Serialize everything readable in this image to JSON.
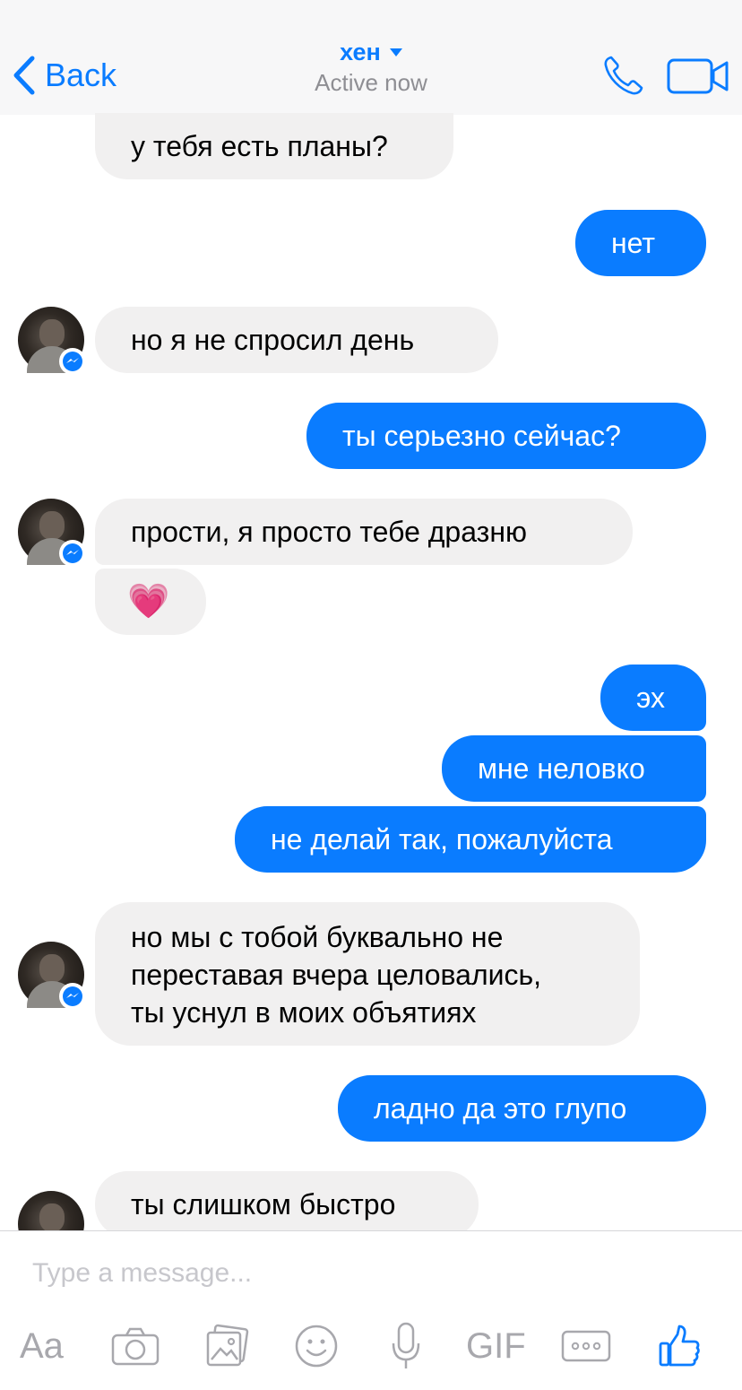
{
  "header": {
    "back_label": "Back",
    "contact_name": "хен",
    "status": "Active now"
  },
  "messages": [
    {
      "sender": "them",
      "text": "у тебя есть планы?"
    },
    {
      "sender": "me",
      "text": "нет"
    },
    {
      "sender": "them",
      "text": "но я не спросил день"
    },
    {
      "sender": "me",
      "text": "ты серьезно сейчас?"
    },
    {
      "sender": "them",
      "text": "прости, я просто тебе дразню"
    },
    {
      "sender": "them",
      "text": "💗"
    },
    {
      "sender": "me",
      "text": "эх"
    },
    {
      "sender": "me",
      "text": "мне неловко"
    },
    {
      "sender": "me",
      "text": "не делай так, пожалуйста"
    },
    {
      "sender": "them",
      "lines": [
        "но мы с тобой буквально не",
        "переставая вчера целовались,",
        "ты уснул в моих объятиях"
      ]
    },
    {
      "sender": "me",
      "text": "ладно да это глупо"
    },
    {
      "sender": "them",
      "text": "ты слишком быстро"
    }
  ],
  "composer": {
    "placeholder": "Type a message...",
    "text_button": "Aa",
    "gif_button": "GIF"
  },
  "colors": {
    "accent": "#0a7cff",
    "incoming_bubble": "#f1f0f0",
    "outgoing_bubble": "#0a7cff",
    "header_bg": "#f7f7f8",
    "toolbar_icon": "#a8a8ad"
  },
  "icons": [
    "chevron-left-icon",
    "caret-down-icon",
    "phone-icon",
    "video-camera-icon",
    "messenger-badge-icon",
    "camera-icon",
    "photo-gallery-icon",
    "emoji-icon",
    "microphone-icon",
    "more-icon",
    "thumbs-up-icon"
  ]
}
